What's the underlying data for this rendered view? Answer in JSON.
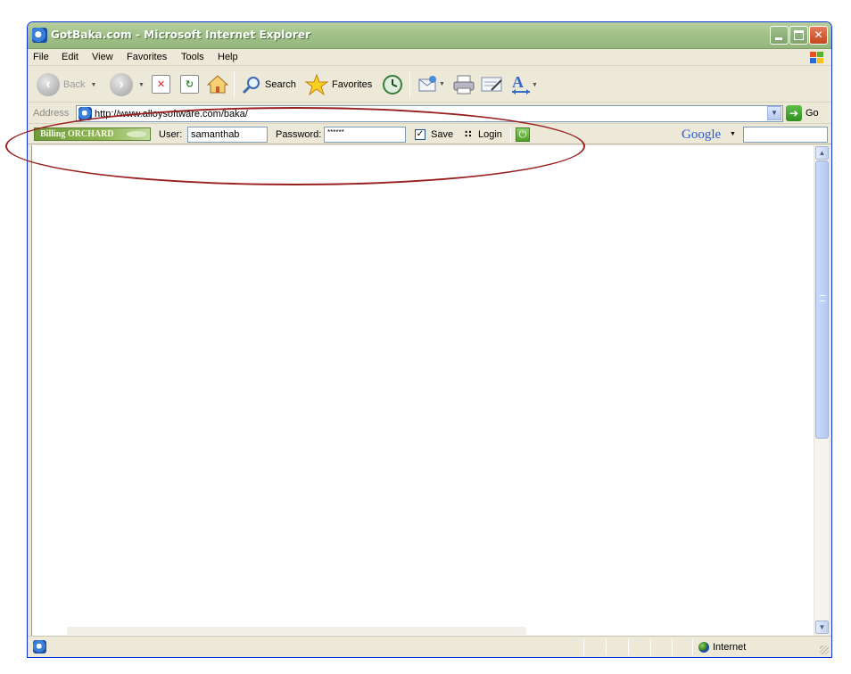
{
  "window": {
    "title": "GotBaka.com - Microsoft Internet Explorer"
  },
  "menu": {
    "items": [
      "File",
      "Edit",
      "View",
      "Favorites",
      "Tools",
      "Help"
    ]
  },
  "toolbar": {
    "back_label": "Back",
    "search_label": "Search",
    "favorites_label": "Favorites"
  },
  "address": {
    "label": "Address",
    "url": "http://www.alloysoftware.com/baka/",
    "go_label": "Go"
  },
  "billing": {
    "logo_text": "Billing ORCHARD",
    "user_label": "User:",
    "user_value": "samanthab",
    "password_label": "Password:",
    "password_value": "******",
    "save_label": "Save",
    "save_checked": true,
    "login_label": "Login"
  },
  "google": {
    "logo": "Google"
  },
  "status": {
    "zone": "Internet"
  },
  "colors": {
    "titlebar": "#a2c28a",
    "annotation": "#9a1f1f",
    "chrome": "#ece9d8"
  }
}
